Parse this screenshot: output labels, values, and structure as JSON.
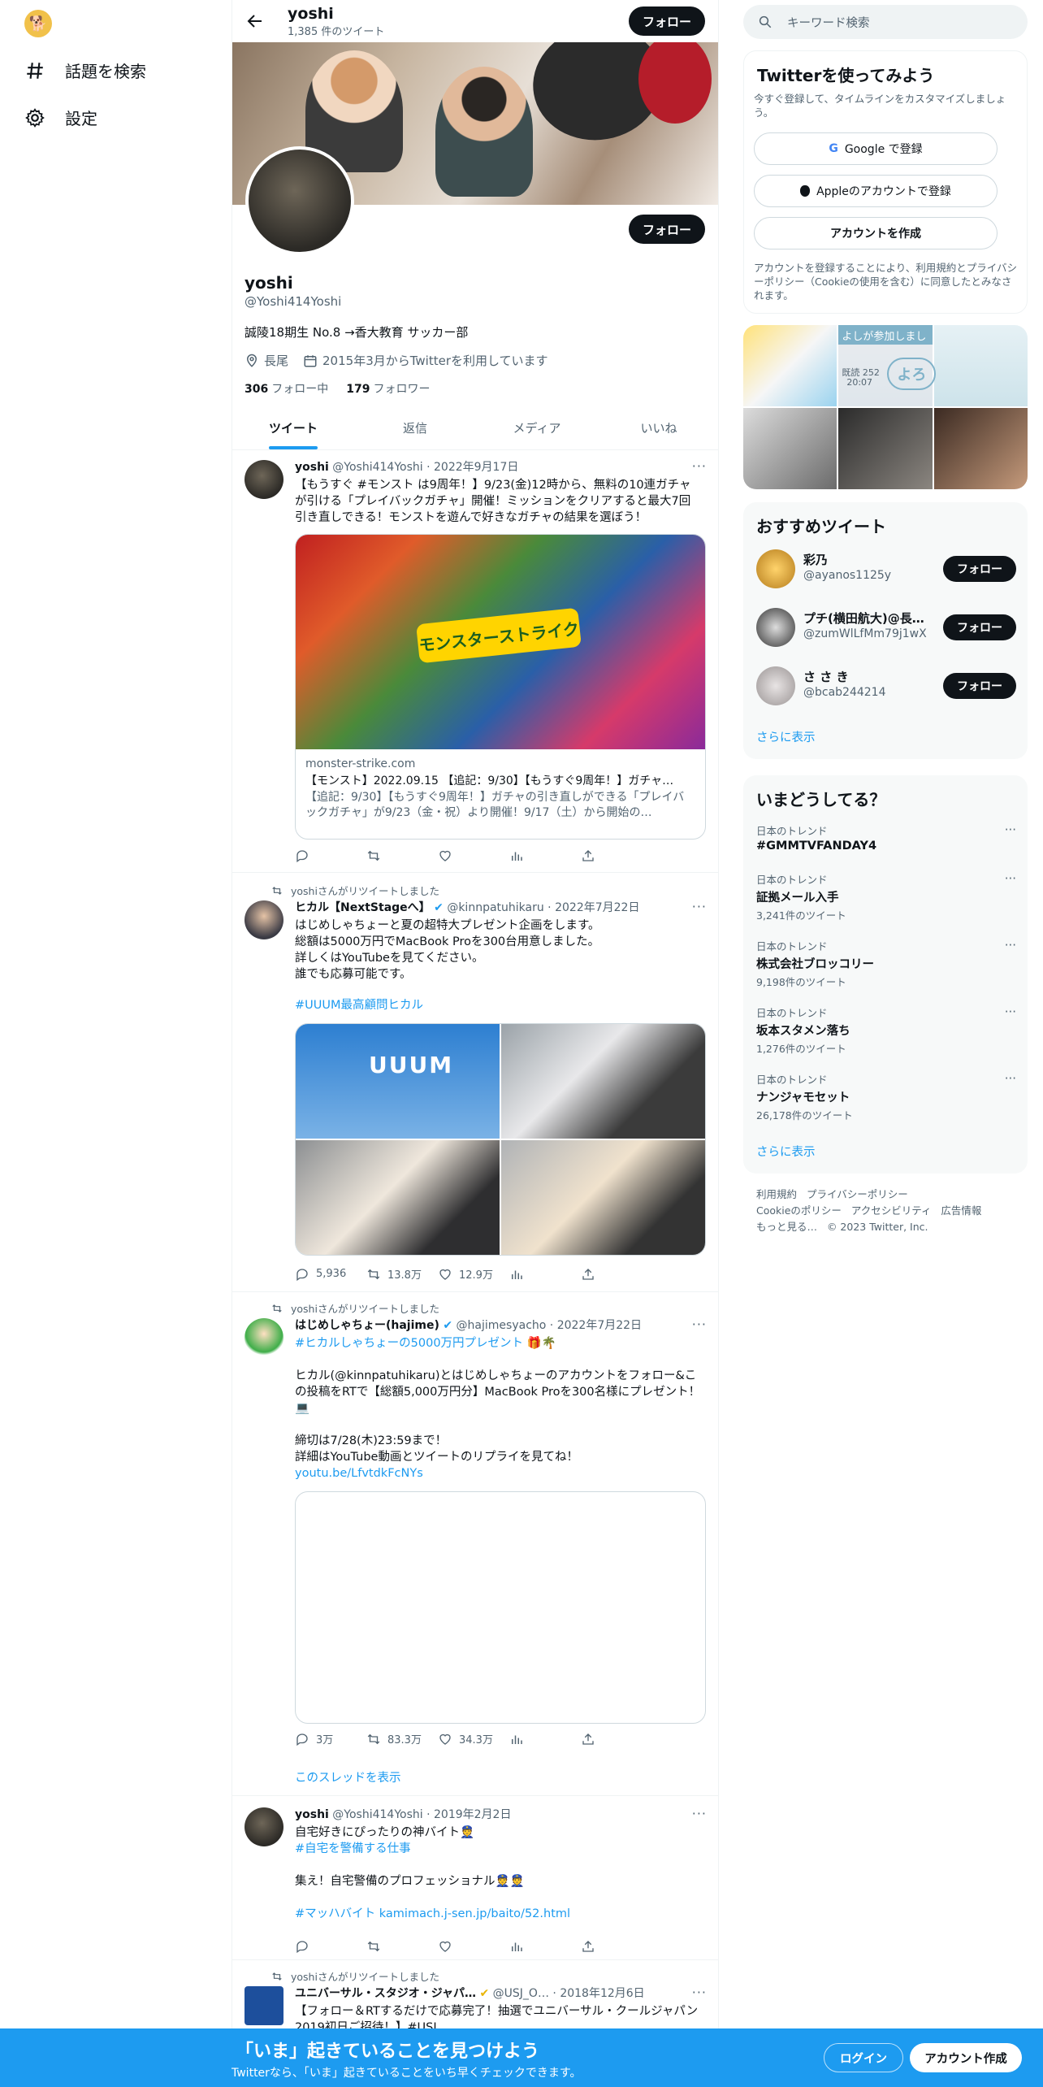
{
  "left_nav": {
    "explore_label": "話題を検索",
    "settings_label": "設定"
  },
  "header": {
    "name": "yoshi",
    "tweet_count": "1,385 件のツイート",
    "follow_label": "フォロー"
  },
  "profile": {
    "name": "yoshi",
    "handle": "@Yoshi414Yoshi",
    "follow_label": "フォロー",
    "bio": "誠陵18期生 No.8 →香大教育 サッカー部",
    "location": "長尾",
    "joined": "2015年3月からTwitterを利用しています",
    "following_count": "306",
    "following_label": "フォロー中",
    "followers_count": "179",
    "followers_label": "フォロワー"
  },
  "tabs": [
    "ツイート",
    "返信",
    "メディア",
    "いいね"
  ],
  "tweets": [
    {
      "name": "yoshi",
      "handle": "@Yoshi414Yoshi",
      "date": "2022年9月17日",
      "text": "【もうすぐ #モンスト は9周年！】9/23(金)12時から、無料の10連ガチャが引ける「プレイバックガチャ」開催！ミッションをクリアすると最大7回引き直しできる！モンストを遊んで好きなガチャの結果を選ぼう！",
      "card_domain": "monster-strike.com",
      "card_title": "【モンスト】2022.09.15 【追記：9/30】【もうすぐ9周年！】ガチャ…",
      "card_desc": "【追記：9/30】【もうすぐ9周年！】ガチャの引き直しができる「プレイバックガチャ」が9/23（金・祝）より開催！9/17（土）から開始の…",
      "card_logo": "モンスターストライク"
    },
    {
      "retweet_label": "yoshiさんがリツイートしました",
      "name": "ヒカル【NextStageへ】",
      "handle": "@kinnpatuhikaru",
      "date": "2022年7月22日",
      "text": "はじめしゃちょーと夏の超特大プレゼント企画をします。\n総額は5000万円でMacBook Proを300台用意しました。\n詳しくはYouTubeを見てください。\n誰でも応募可能です。",
      "hashtag": "#UUUM最高顧問ヒカル",
      "replies": "5,936",
      "retweets": "13.8万",
      "likes": "12.9万",
      "photo_text": "UUUM"
    },
    {
      "retweet_label": "yoshiさんがリツイートしました",
      "name": "はじめしゃちょー(hajime)",
      "handle": "@hajimesyacho",
      "date": "2022年7月22日",
      "hashtag": "#ヒカルしゃちょーの5000万円プレゼント 🎁🌴",
      "text": "ヒカル(@kinnpatuhikaru)とはじめしゃちょーのアカウントをフォロー&この投稿をRTで【総額5,000万円分】MacBook Proを300名様にプレゼント！💻\n\n締切は7/28(木)23:59まで！\n詳細はYouTube動画とツイートのリプライを見てね！",
      "link": "youtu.be/LfvtdkFcNYs",
      "replies": "3万",
      "retweets": "83.3万",
      "likes": "34.3万",
      "thread_label": "このスレッドを表示"
    },
    {
      "name": "yoshi",
      "handle": "@Yoshi414Yoshi",
      "date": "2019年2月2日",
      "text1": "自宅好きにぴったりの神バイト👮",
      "hashtag1": "#自宅を警備する仕事",
      "text2": "集え！自宅警備のプロフェッショナル👮👮",
      "hashtag2": "#マッハバイト",
      "link": "kamimach.j-sen.jp/baito/52.html"
    },
    {
      "retweet_label": "yoshiさんがリツイートしました",
      "name": "ユニバーサル・スタジオ・ジャパ…",
      "handle": "@USJ_O…",
      "date": "2018年12月6日",
      "text": "【フォロー＆RTするだけで応募完了！抽選でユニバーサル・クールジャパン 2019初日ご招待！】#USJ"
    }
  ],
  "right": {
    "search_placeholder": "キーワード検索",
    "signup": {
      "title": "Twitterを使ってみよう",
      "subtitle": "今すぐ登録して、タイムラインをカスタマイズしましょう。",
      "google": "Google で登録",
      "apple": "Appleのアカウントで登録",
      "create": "アカウントを作成",
      "legal": "アカウントを登録することにより、利用規約とプライバシーポリシー（Cookieの使用を含む）に同意したとみなされます。"
    },
    "media_texts": {
      "m2_top": "よしが参加しまし",
      "m2_date": "20:07",
      "m2_yoro": "よろ",
      "m2_left": "既読 252"
    },
    "recommend": {
      "title": "おすすめツイート",
      "more": "さらに表示",
      "follow": "フォロー",
      "users": [
        {
          "name": "彩乃",
          "handle": "@ayanos1125y"
        },
        {
          "name": "プチ(横田航大)@長…",
          "handle": "@zumWlLfMm79j1wX"
        },
        {
          "name": "さ さ き",
          "handle": "@bcab244214"
        }
      ]
    },
    "trends": {
      "title": "いまどうしてる？",
      "more": "さらに表示",
      "items": [
        {
          "cat": "日本のトレンド",
          "name": "#GMMTVFANDAY4",
          "count": ""
        },
        {
          "cat": "日本のトレンド",
          "name": "証拠メール入手",
          "count": "3,241件のツイート"
        },
        {
          "cat": "日本のトレンド",
          "name": "株式会社ブロッコリー",
          "count": "9,198件のツイート"
        },
        {
          "cat": "日本のトレンド",
          "name": "坂本スタメン落ち",
          "count": "1,276件のツイート"
        },
        {
          "cat": "日本のトレンド",
          "name": "ナンジャモセット",
          "count": "26,178件のツイート"
        }
      ]
    },
    "footer": {
      "l1": "利用規約",
      "l2": "プライバシーポリシー",
      "l3": "Cookieのポリシー",
      "l4": "アクセシビリティ",
      "l5": "広告情報",
      "l6": "もっと見る…",
      "copy": "© 2023 Twitter, Inc."
    }
  },
  "bottom": {
    "title": "「いま」起きていることを見つけよう",
    "subtitle": "Twitterなら、「いま」起きていることをいち早くチェックできます。",
    "login": "ログイン",
    "signup": "アカウント作成"
  }
}
